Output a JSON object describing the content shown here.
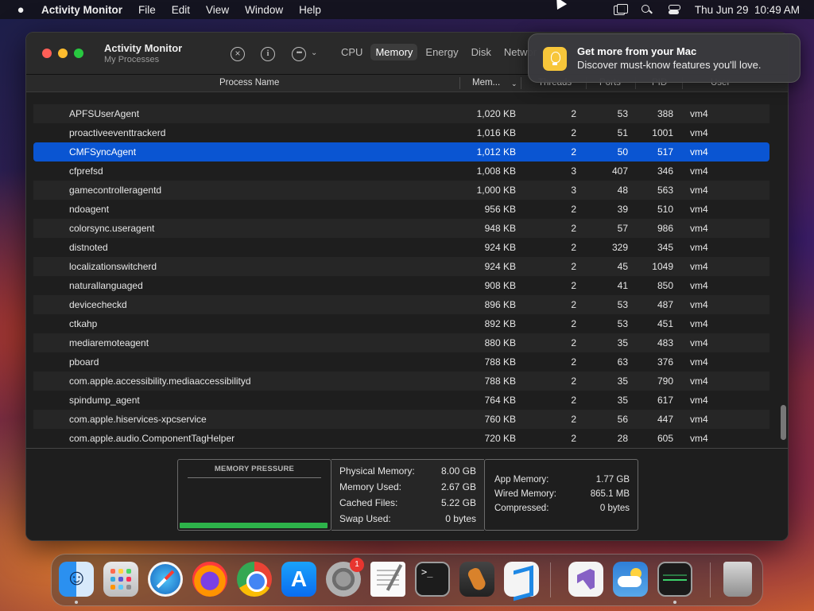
{
  "menubar": {
    "app_name": "Activity Monitor",
    "menus": [
      "File",
      "Edit",
      "View",
      "Window",
      "Help"
    ],
    "datetime": "Thu Jun 29  10:49 AM"
  },
  "window": {
    "title": "Activity Monitor",
    "subtitle": "My Processes",
    "tabs": [
      "CPU",
      "Memory",
      "Energy",
      "Disk",
      "Networ"
    ],
    "active_tab": "Memory"
  },
  "table": {
    "columns": {
      "name": "Process Name",
      "memory": "Mem...",
      "threads": "Threads",
      "ports": "Ports",
      "pid": "PID",
      "user": "User"
    },
    "selected_row": 2,
    "rows": [
      {
        "name": "APFSUserAgent",
        "memory": "1,020 KB",
        "threads": "2",
        "ports": "53",
        "pid": "388",
        "user": "vm4"
      },
      {
        "name": "proactiveeventtrackerd",
        "memory": "1,016 KB",
        "threads": "2",
        "ports": "51",
        "pid": "1001",
        "user": "vm4"
      },
      {
        "name": "CMFSyncAgent",
        "memory": "1,012 KB",
        "threads": "2",
        "ports": "50",
        "pid": "517",
        "user": "vm4"
      },
      {
        "name": "cfprefsd",
        "memory": "1,008 KB",
        "threads": "3",
        "ports": "407",
        "pid": "346",
        "user": "vm4"
      },
      {
        "name": "gamecontrolleragentd",
        "memory": "1,000 KB",
        "threads": "3",
        "ports": "48",
        "pid": "563",
        "user": "vm4"
      },
      {
        "name": "ndoagent",
        "memory": "956 KB",
        "threads": "2",
        "ports": "39",
        "pid": "510",
        "user": "vm4"
      },
      {
        "name": "colorsync.useragent",
        "memory": "948 KB",
        "threads": "2",
        "ports": "57",
        "pid": "986",
        "user": "vm4"
      },
      {
        "name": "distnoted",
        "memory": "924 KB",
        "threads": "2",
        "ports": "329",
        "pid": "345",
        "user": "vm4"
      },
      {
        "name": "localizationswitcherd",
        "memory": "924 KB",
        "threads": "2",
        "ports": "45",
        "pid": "1049",
        "user": "vm4"
      },
      {
        "name": "naturallanguaged",
        "memory": "908 KB",
        "threads": "2",
        "ports": "41",
        "pid": "850",
        "user": "vm4"
      },
      {
        "name": "devicecheckd",
        "memory": "896 KB",
        "threads": "2",
        "ports": "53",
        "pid": "487",
        "user": "vm4"
      },
      {
        "name": "ctkahp",
        "memory": "892 KB",
        "threads": "2",
        "ports": "53",
        "pid": "451",
        "user": "vm4"
      },
      {
        "name": "mediaremoteagent",
        "memory": "880 KB",
        "threads": "2",
        "ports": "35",
        "pid": "483",
        "user": "vm4"
      },
      {
        "name": "pboard",
        "memory": "788 KB",
        "threads": "2",
        "ports": "63",
        "pid": "376",
        "user": "vm4"
      },
      {
        "name": "com.apple.accessibility.mediaaccessibilityd",
        "memory": "788 KB",
        "threads": "2",
        "ports": "35",
        "pid": "790",
        "user": "vm4"
      },
      {
        "name": "spindump_agent",
        "memory": "764 KB",
        "threads": "2",
        "ports": "35",
        "pid": "617",
        "user": "vm4"
      },
      {
        "name": "com.apple.hiservices-xpcservice",
        "memory": "760 KB",
        "threads": "2",
        "ports": "56",
        "pid": "447",
        "user": "vm4"
      },
      {
        "name": "com.apple.audio.ComponentTagHelper",
        "memory": "720 KB",
        "threads": "2",
        "ports": "28",
        "pid": "605",
        "user": "vm4"
      }
    ]
  },
  "memory_pressure": {
    "title": "MEMORY PRESSURE",
    "level_fraction": 1.0,
    "color": "#2db34a"
  },
  "stats_left": [
    {
      "label": "Physical Memory:",
      "value": "8.00 GB"
    },
    {
      "label": "Memory Used:",
      "value": "2.67 GB"
    },
    {
      "label": "Cached Files:",
      "value": "5.22 GB"
    },
    {
      "label": "Swap Used:",
      "value": "0 bytes"
    }
  ],
  "stats_right": [
    {
      "label": "App Memory:",
      "value": "1.77 GB"
    },
    {
      "label": "Wired Memory:",
      "value": "865.1 MB"
    },
    {
      "label": "Compressed:",
      "value": "0 bytes"
    }
  ],
  "notification": {
    "title": "Get more from your Mac",
    "body": "Discover must-know features you'll love.",
    "icon": "lightbulb-icon"
  },
  "dock": {
    "apps": [
      {
        "name": "finder-icon",
        "running": true
      },
      {
        "name": "launchpad-icon",
        "running": false
      },
      {
        "name": "safari-icon",
        "running": false
      },
      {
        "name": "firefox-icon",
        "running": false
      },
      {
        "name": "chrome-icon",
        "running": false
      },
      {
        "name": "app-store-icon",
        "running": false
      },
      {
        "name": "system-settings-icon",
        "running": false,
        "badge": "1"
      },
      {
        "name": "textedit-icon",
        "running": false
      },
      {
        "name": "terminal-icon",
        "running": false
      },
      {
        "name": "garageband-icon",
        "running": false
      },
      {
        "name": "vscode-icon",
        "running": false
      },
      {
        "name": "visual-studio-icon",
        "running": false
      },
      {
        "name": "weather-icon",
        "running": false
      },
      {
        "name": "activity-monitor-icon",
        "running": true
      },
      {
        "name": "trash-icon",
        "running": false
      }
    ]
  }
}
